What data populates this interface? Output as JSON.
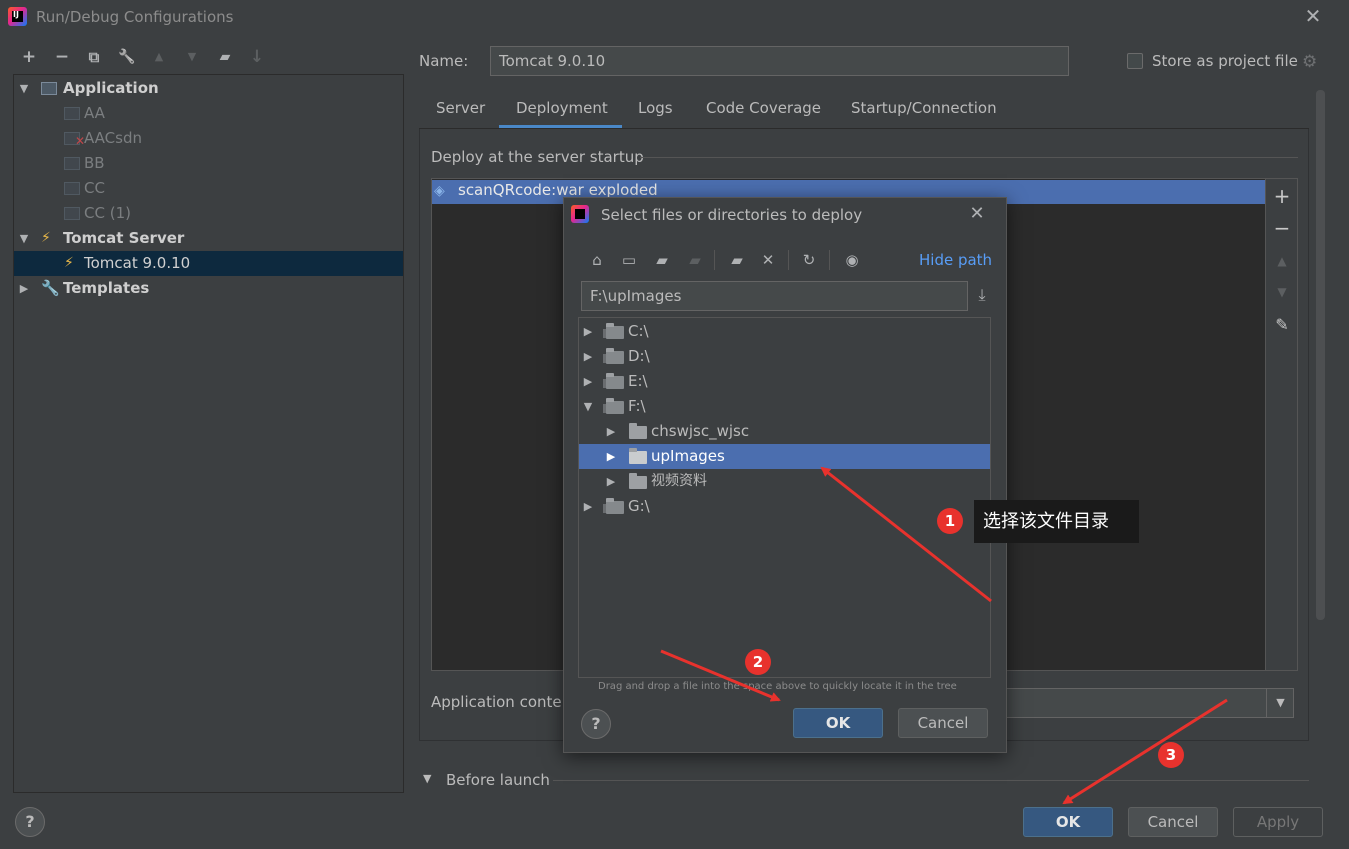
{
  "window": {
    "title": "Run/Debug Configurations",
    "close_glyph": "✕"
  },
  "toolbar": {
    "add": "+",
    "remove": "−",
    "copy": "⧉",
    "edit_defaults": "🔧",
    "move_up": "▲",
    "move_down": "▼",
    "folder": "▰",
    "sort": "↓"
  },
  "tree": {
    "items": [
      {
        "label": "Application",
        "type": "group",
        "expanded": true
      },
      {
        "label": "AA",
        "type": "app"
      },
      {
        "label": "AACsdn",
        "type": "app",
        "error": true
      },
      {
        "label": "BB",
        "type": "app"
      },
      {
        "label": "CC",
        "type": "app"
      },
      {
        "label": "CC (1)",
        "type": "app"
      },
      {
        "label": "Tomcat Server",
        "type": "group",
        "expanded": true
      },
      {
        "label": "Tomcat 9.0.10",
        "type": "tomcat",
        "selected": true
      },
      {
        "label": "Templates",
        "type": "group",
        "expanded": false
      }
    ]
  },
  "config": {
    "name_label": "Name:",
    "name_value": "Tomcat 9.0.10",
    "store_label": "Store as project file",
    "store_checked": false
  },
  "tabs": [
    {
      "label": "Server",
      "active": false
    },
    {
      "label": "Deployment",
      "active": true
    },
    {
      "label": "Logs",
      "active": false
    },
    {
      "label": "Code Coverage",
      "active": false
    },
    {
      "label": "Startup/Connection",
      "active": false
    }
  ],
  "deployment": {
    "section_title": "Deploy at the server startup",
    "items": [
      "scanQRcode:war exploded"
    ],
    "app_context_label": "Application conte",
    "before_launch": "Before launch"
  },
  "buttons": {
    "ok": "OK",
    "cancel": "Cancel",
    "apply": "Apply",
    "help": "?"
  },
  "dialog": {
    "title": "Select files or directories to deploy",
    "hide_path": "Hide path",
    "path_value": "F:\\upImages",
    "tree": [
      {
        "label": "C:\\",
        "level": 0,
        "expanded": false,
        "drive": true
      },
      {
        "label": "D:\\",
        "level": 0,
        "expanded": false,
        "drive": true
      },
      {
        "label": "E:\\",
        "level": 0,
        "expanded": false,
        "drive": true
      },
      {
        "label": "F:\\",
        "level": 0,
        "expanded": true,
        "drive": true
      },
      {
        "label": "chswjsc_wjsc",
        "level": 1,
        "expanded": false
      },
      {
        "label": "upImages",
        "level": 1,
        "expanded": false,
        "selected": true
      },
      {
        "label": "视频资料",
        "level": 1,
        "expanded": false
      },
      {
        "label": "G:\\",
        "level": 0,
        "expanded": false,
        "drive": true
      }
    ],
    "hint": "Drag and drop a file into the space above to quickly locate it in the tree",
    "ok": "OK",
    "cancel": "Cancel",
    "help": "?"
  },
  "annotations": {
    "badge1": "1",
    "badge2": "2",
    "badge3": "3",
    "callout": "选择该文件目录",
    "color": "#e8322d"
  }
}
